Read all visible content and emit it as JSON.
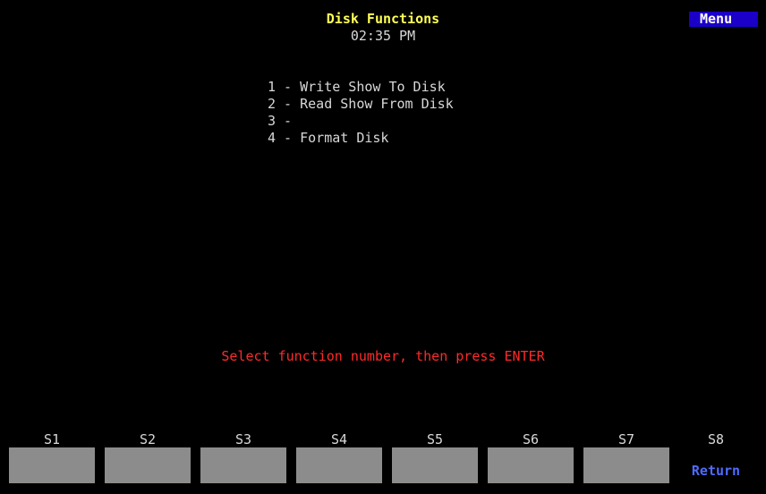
{
  "header": {
    "title": "Disk Functions",
    "clock": "02:35 PM",
    "menu_badge": "Menu"
  },
  "menu": {
    "items": [
      "1 - Write Show To Disk",
      "2 - Read Show From Disk",
      "3 -",
      "4 - Format Disk"
    ]
  },
  "prompt": "Select function number, then press ENTER",
  "softkeys": [
    {
      "label": "S1",
      "text": ""
    },
    {
      "label": "S2",
      "text": ""
    },
    {
      "label": "S3",
      "text": ""
    },
    {
      "label": "S4",
      "text": ""
    },
    {
      "label": "S5",
      "text": ""
    },
    {
      "label": "S6",
      "text": ""
    },
    {
      "label": "S7",
      "text": ""
    },
    {
      "label": "S8",
      "text": "Return"
    }
  ],
  "colors": {
    "background": "#000000",
    "title": "#ffff55",
    "text": "#d8d8d8",
    "prompt": "#ff2a2a",
    "menu_badge_bg": "#1a00c8",
    "softkey_bg": "#8c8c8c",
    "return_text": "#4f6cff"
  }
}
